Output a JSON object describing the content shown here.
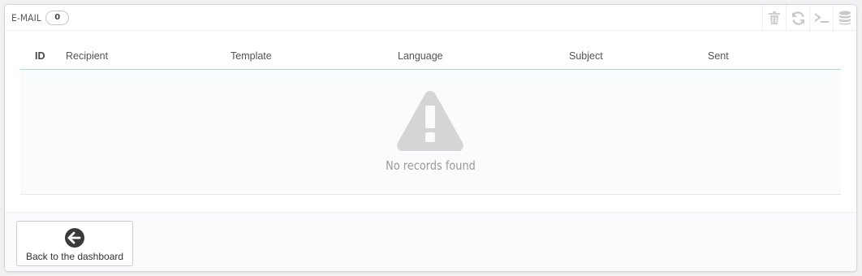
{
  "panel": {
    "title": "E-MAIL",
    "count": "0"
  },
  "toolbar": {
    "icons": [
      "trash-icon",
      "refresh-icon",
      "terminal-icon",
      "database-icon"
    ]
  },
  "table": {
    "columns": [
      "ID",
      "Recipient",
      "Template",
      "Language",
      "Subject",
      "Sent"
    ],
    "empty_message": "No records found"
  },
  "footer": {
    "back_label": "Back to the dashboard"
  },
  "colors": {
    "header_border": "#a7dfcf",
    "icon_gray": "#cccccc",
    "warning_gray": "#d5d5d5",
    "back_icon": "#3a3a3a"
  }
}
